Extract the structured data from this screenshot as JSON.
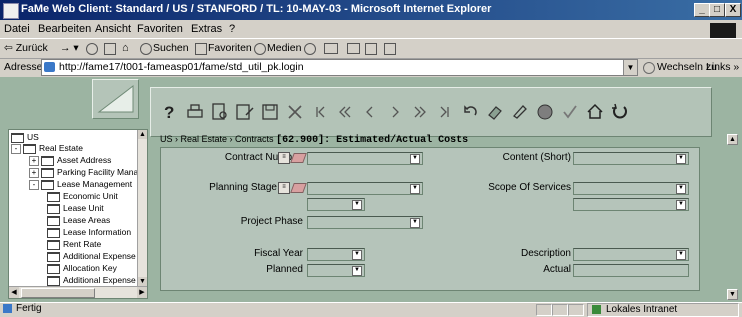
{
  "window": {
    "title": "FaMe Web Client: Standard / US / STANFORD / TL: 10-MAY-03 - Microsoft Internet Explorer",
    "minimize": "_",
    "maximize": "□",
    "close": "X"
  },
  "menu": [
    "Datei",
    "Bearbeiten",
    "Ansicht",
    "Favoriten",
    "Extras",
    "?"
  ],
  "toolbar": {
    "back": "⇦ Zurück",
    "search": "Suchen",
    "favorites": "Favoriten",
    "media": "Medien"
  },
  "address": {
    "label": "Adresse",
    "url": "http://fame17/t001-fameasp01/fame/std_util_pk.login",
    "go": "Wechseln zu",
    "links": "Links »"
  },
  "tree": {
    "nodes": [
      {
        "label": "US",
        "expand": ""
      },
      {
        "label": "Real Estate",
        "expand": "-"
      },
      {
        "label": "Asset Address",
        "expand": "+"
      },
      {
        "label": "Parking Facility Manage",
        "expand": "+"
      },
      {
        "label": "Lease Management",
        "expand": "-"
      },
      {
        "label": "Economic Unit",
        "expand": ""
      },
      {
        "label": "Lease Unit",
        "expand": ""
      },
      {
        "label": "Lease Areas",
        "expand": ""
      },
      {
        "label": "Lease Information",
        "expand": ""
      },
      {
        "label": "Rent Rate",
        "expand": ""
      },
      {
        "label": "Additional Expense",
        "expand": ""
      },
      {
        "label": "Allocation Key",
        "expand": ""
      },
      {
        "label": "Additional Expense",
        "expand": ""
      }
    ]
  },
  "breadcrumb": {
    "path": "US › Real Estate › Contracts",
    "title": "[62.900]: Estimated/Actual Costs"
  },
  "form": {
    "contract_number": {
      "label": "Contract Number",
      "value": ""
    },
    "content_short": {
      "label": "Content (Short)",
      "value": ""
    },
    "planning_stage": {
      "label": "Planning Stage",
      "value": ""
    },
    "scope_of_services": {
      "label": "Scope Of Services",
      "value": ""
    },
    "project_phase": {
      "label": "Project Phase",
      "value": ""
    },
    "fiscal_year": {
      "label": "Fiscal Year",
      "value": ""
    },
    "description": {
      "label": "Description",
      "value": ""
    },
    "planned": {
      "label": "Planned",
      "value": ""
    },
    "actual": {
      "label": "Actual",
      "value": ""
    }
  },
  "status": {
    "left": "Fertig",
    "zone": "Lokales Intranet"
  },
  "colors": {
    "app_bg": "#9cb4a2",
    "panel": "#b5c4ba",
    "titlebar": "#0a246a"
  }
}
